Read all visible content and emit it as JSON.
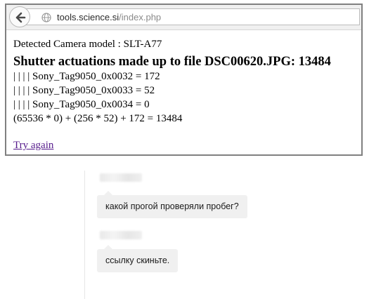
{
  "browser": {
    "url_host": "tools.science.si",
    "url_path": "/index.php"
  },
  "page": {
    "detected_model": "Detected Camera model : SLT-A77",
    "heading": "Shutter actuations made up to file DSC00620.JPG: 13484",
    "tag_lines": [
      "| | | | Sony_Tag9050_0x0032 = 172",
      "| | | | Sony_Tag9050_0x0033 = 52",
      "| | | | Sony_Tag9050_0x0034 = 0"
    ],
    "formula": "(65536 * 0) + (256 * 52) + 172 = 13484",
    "try_again": "Try again"
  },
  "chat": {
    "messages": [
      {
        "text": "какой прогой проверяли пробег?"
      },
      {
        "text": "ссылку скиньте."
      }
    ]
  },
  "colors": {
    "link_visited": "#551a8b",
    "bubble_bg": "#f0f0f0",
    "frame_border": "#808080"
  },
  "icons": [
    "back-arrow-icon",
    "globe-icon"
  ]
}
